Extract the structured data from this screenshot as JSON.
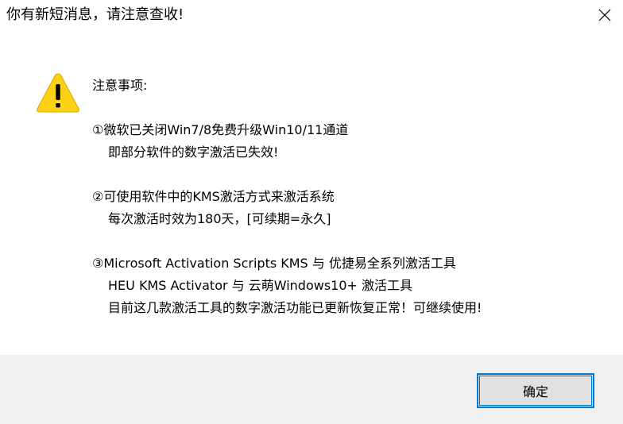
{
  "window": {
    "title": "你有新短消息，请注意查收!",
    "close_icon": "close-icon"
  },
  "message": {
    "icon": "warning-icon",
    "heading": "注意事项:",
    "item1": {
      "line1": "①微软已关闭Win7/8免费升级Win10/11通道",
      "line2": "即部分软件的数字激活已失效!"
    },
    "item2": {
      "line1": "②可使用软件中的KMS激活方式来激活系统",
      "line2": "每次激活时效为180天，[可续期=永久]"
    },
    "item3": {
      "line1": "③Microsoft Activation Scripts KMS  与  优捷易全系列激活工具",
      "line2": "HEU KMS Activator 与 云萌Windows10+ 激活工具",
      "line3": "目前这几款激活工具的数字激活功能已更新恢复正常！可继续使用!"
    }
  },
  "footer": {
    "ok_label": "确定"
  },
  "colors": {
    "accent": "#0078d7",
    "warning_fill": "#fcd116",
    "footer_bg": "#f0f0f0"
  }
}
